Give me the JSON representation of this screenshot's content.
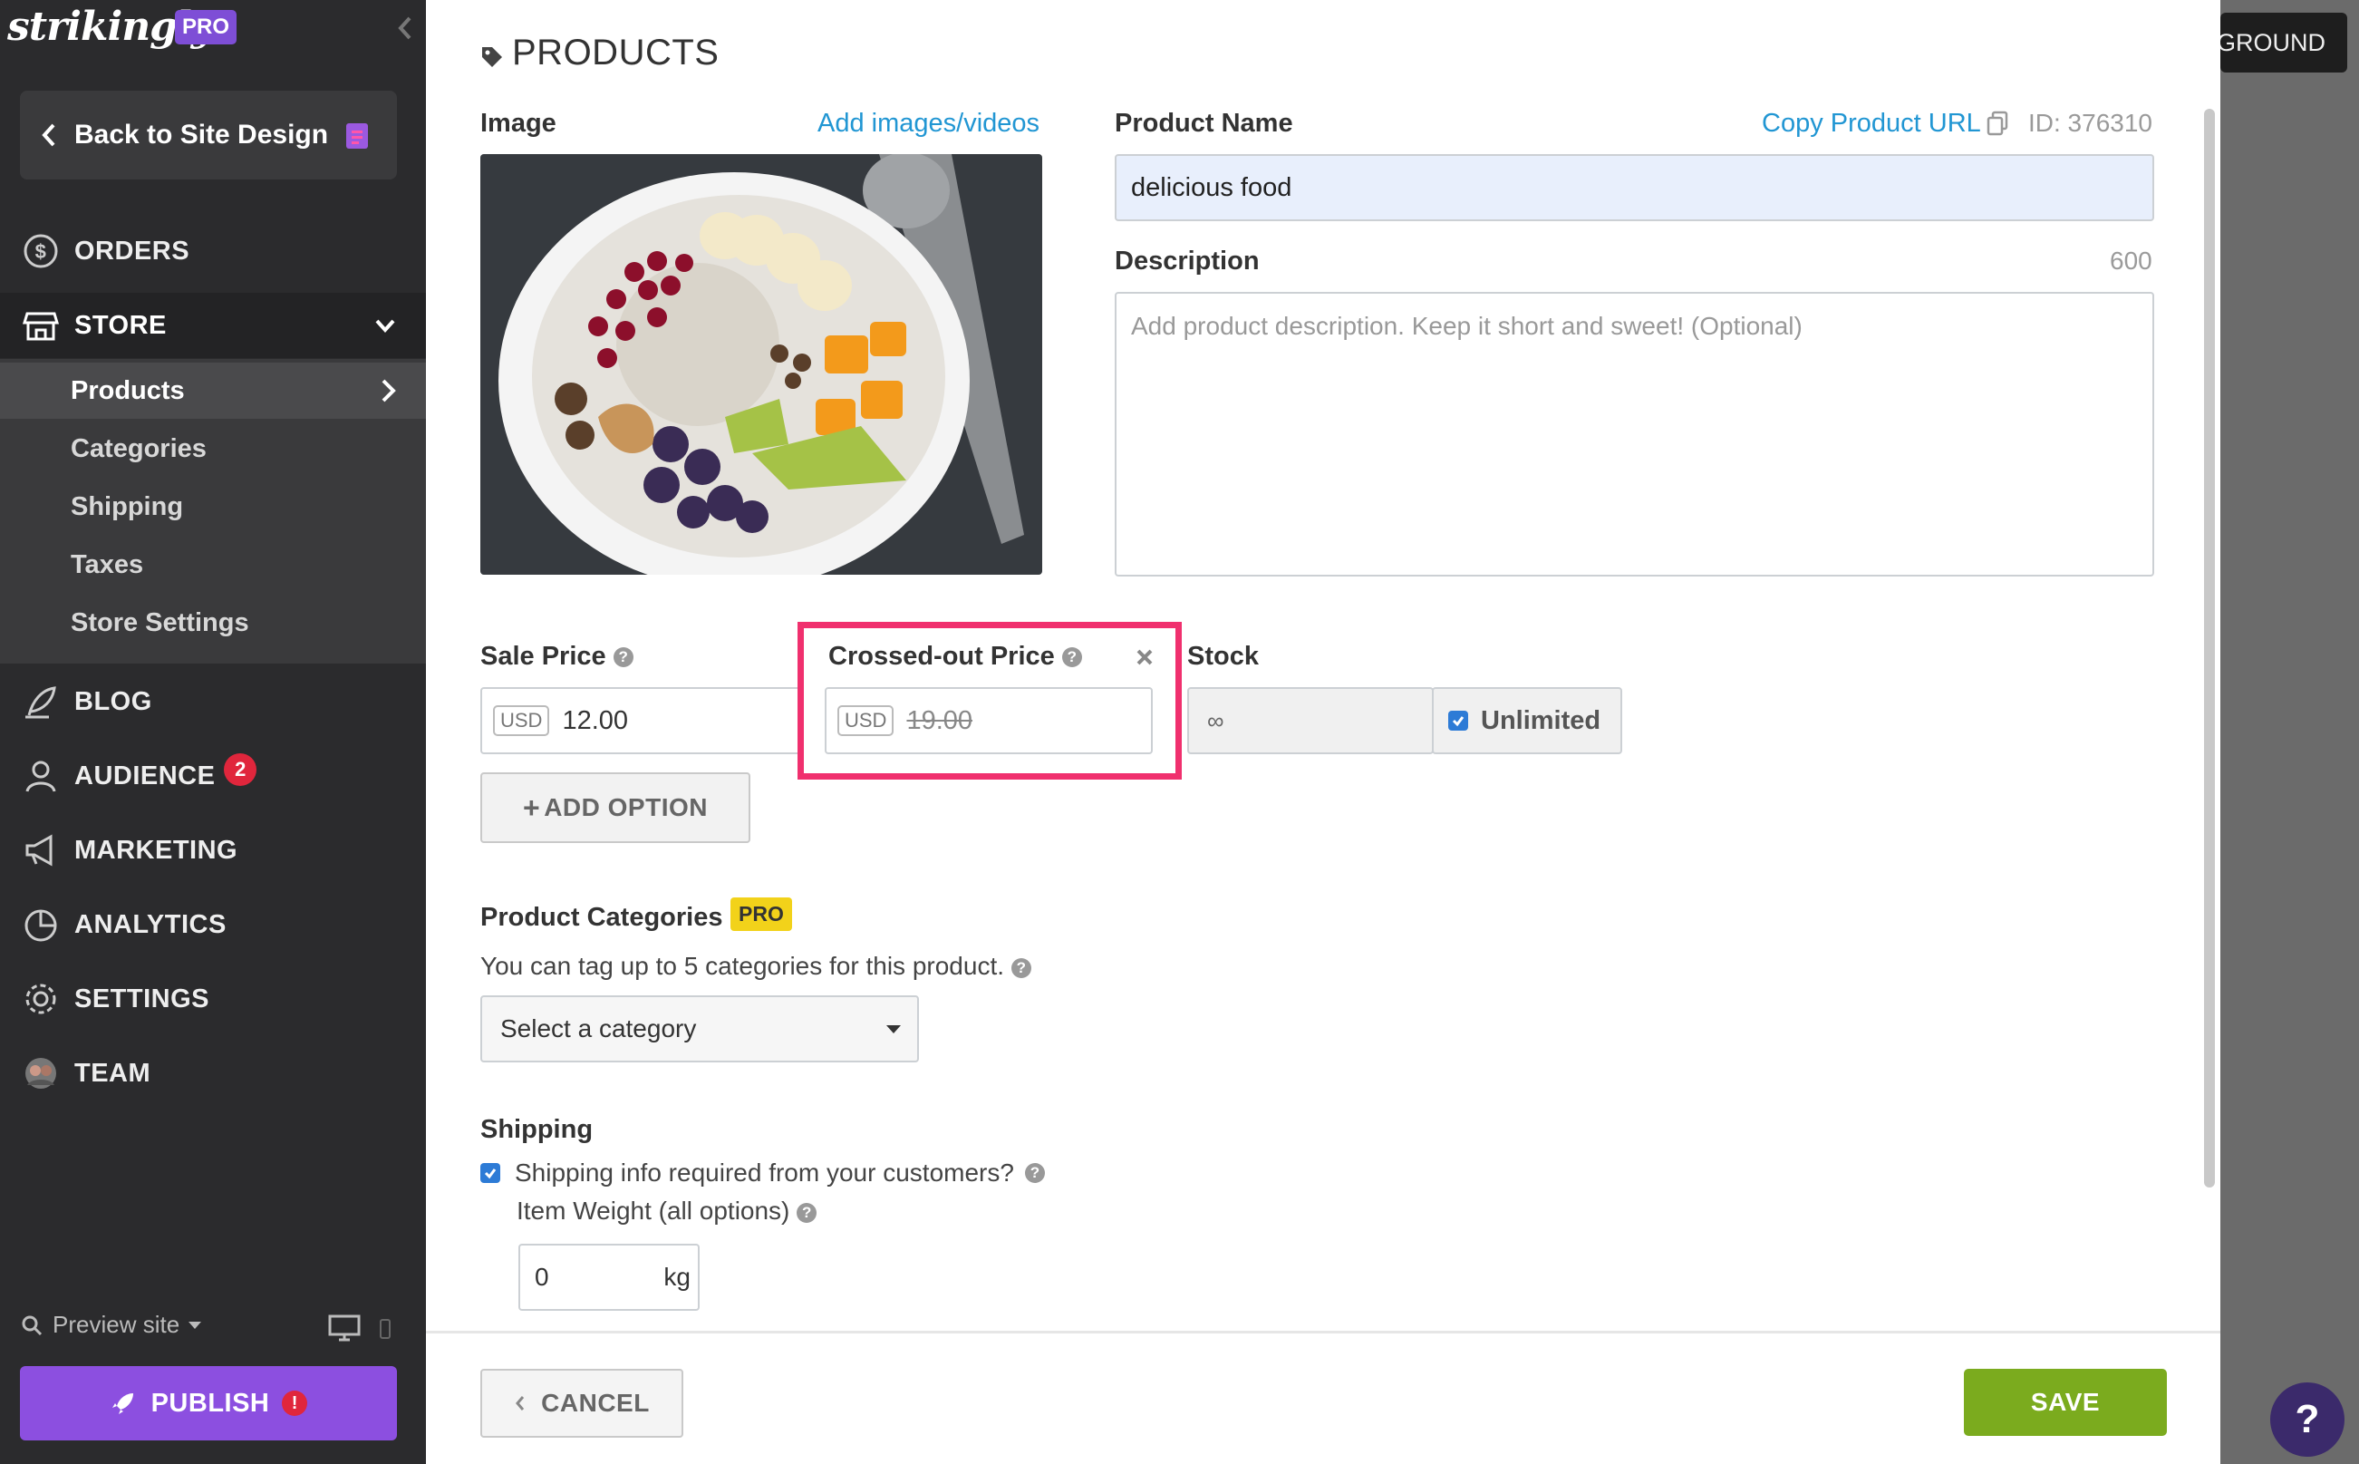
{
  "sidebar": {
    "logo": "strikingly",
    "pro_badge": "PRO",
    "back_label": "Back to Site Design",
    "nav": {
      "orders": "ORDERS",
      "store": "STORE",
      "blog": "BLOG",
      "audience": "AUDIENCE",
      "audience_count": "2",
      "marketing": "MARKETING",
      "analytics": "ANALYTICS",
      "settings": "SETTINGS",
      "team": "TEAM"
    },
    "store_items": [
      "Products",
      "Categories",
      "Shipping",
      "Taxes",
      "Store Settings"
    ],
    "preview_label": "Preview site",
    "publish_label": "PUBLISH",
    "publish_alert": "!"
  },
  "modal": {
    "title": "PRODUCTS",
    "image_label": "Image",
    "add_media_link": "Add images/videos",
    "image_alt": "Bowl of oatmeal with fruit",
    "product_name_label": "Product Name",
    "copy_url_link": "Copy Product URL",
    "product_id": "ID: 376310",
    "product_name_value": "delicious food",
    "description_label": "Description",
    "description_limit": "600",
    "description_placeholder": "Add product description. Keep it short and sweet! (Optional)",
    "sale_price_label": "Sale Price",
    "currency": "USD",
    "sale_price_value": "12.00",
    "crossed_label": "Crossed-out Price",
    "crossed_value": "19.00",
    "stock_label": "Stock",
    "stock_value": "∞",
    "unlimited_label": "Unlimited",
    "add_option_label": "ADD OPTION",
    "categories_label": "Product Categories",
    "categories_pro": "PRO",
    "categories_hint": "You can tag up to 5 categories for this product.",
    "category_select": "Select a category",
    "shipping_label": "Shipping",
    "shipping_check_label": "Shipping info required from your customers?",
    "weight_label": "Item Weight (all options)",
    "weight_value": "0",
    "weight_unit": "kg",
    "cancel_label": "CANCEL",
    "save_label": "SAVE"
  },
  "backdrop": {
    "button_label": "GROUND",
    "help_label": "?"
  },
  "colors": {
    "sidebar_bg": "#2b2b2d",
    "accent_purple": "#8c4fe0",
    "link_blue": "#2196d3",
    "highlight_pink": "#f0306e",
    "save_green": "#7bab1e",
    "input_highlight": "#e8effc"
  }
}
